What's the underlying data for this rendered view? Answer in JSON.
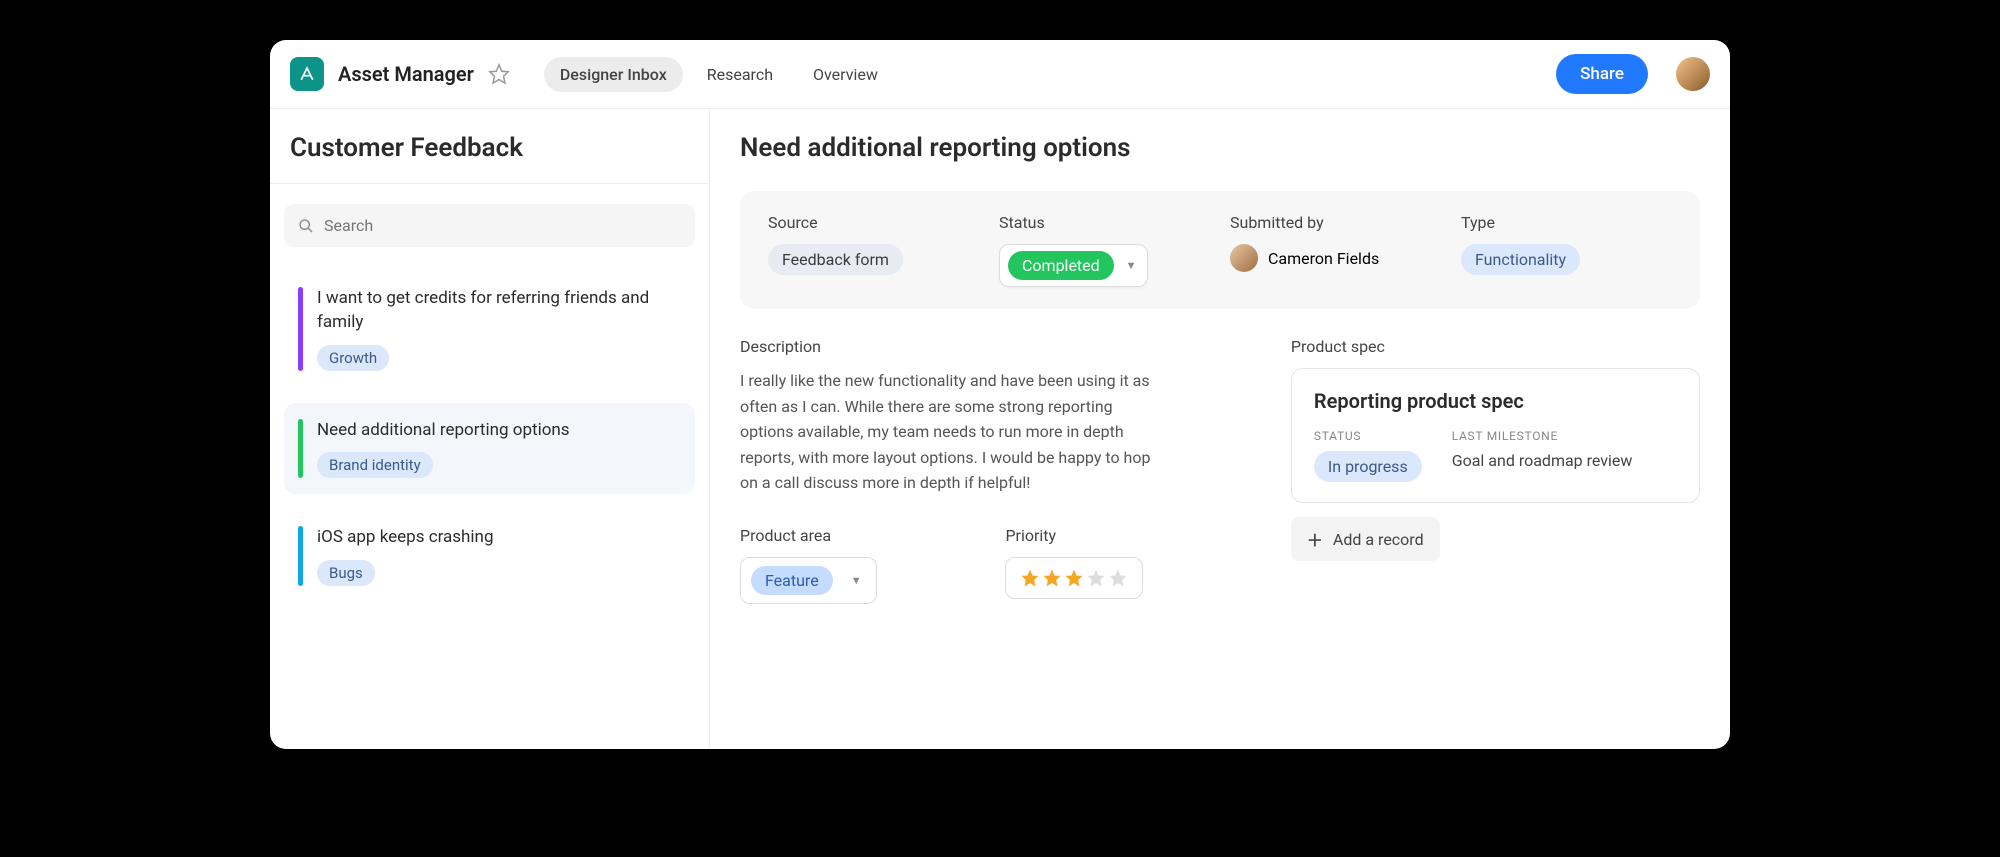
{
  "header": {
    "app_title": "Asset Manager",
    "tabs": [
      "Designer Inbox",
      "Research",
      "Overview"
    ],
    "active_tab": 0,
    "share_label": "Share"
  },
  "sidebar": {
    "title": "Customer Feedback",
    "search_placeholder": "Search",
    "items": [
      {
        "title": "I want to get credits for referring friends and family",
        "tag": "Growth",
        "bar": "purple"
      },
      {
        "title": "Need additional reporting options",
        "tag": "Brand identity",
        "bar": "green",
        "selected": true
      },
      {
        "title": "iOS app keeps crashing",
        "tag": "Bugs",
        "bar": "cyan"
      }
    ]
  },
  "detail": {
    "title": "Need additional reporting options",
    "meta": {
      "source": {
        "label": "Source",
        "value": "Feedback form"
      },
      "status": {
        "label": "Status",
        "value": "Completed"
      },
      "submitted_by": {
        "label": "Submitted by",
        "value": "Cameron Fields"
      },
      "type": {
        "label": "Type",
        "value": "Functionality"
      }
    },
    "description": {
      "label": "Description",
      "text": "I really like the new functionality and have been using it as often as I can. While there are some strong reporting options available, my team needs to run more in depth reports, with more layout options. I would be happy to hop on a call discuss more in depth if helpful!"
    },
    "product_area": {
      "label": "Product area",
      "value": "Feature"
    },
    "priority": {
      "label": "Priority",
      "value": 3,
      "max": 5
    },
    "product_spec": {
      "label": "Product spec",
      "card_title": "Reporting product spec",
      "status_label": "STATUS",
      "status_value": "In progress",
      "milestone_label": "LAST MILESTONE",
      "milestone_value": "Goal and roadmap review",
      "add_label": "Add a record"
    }
  }
}
